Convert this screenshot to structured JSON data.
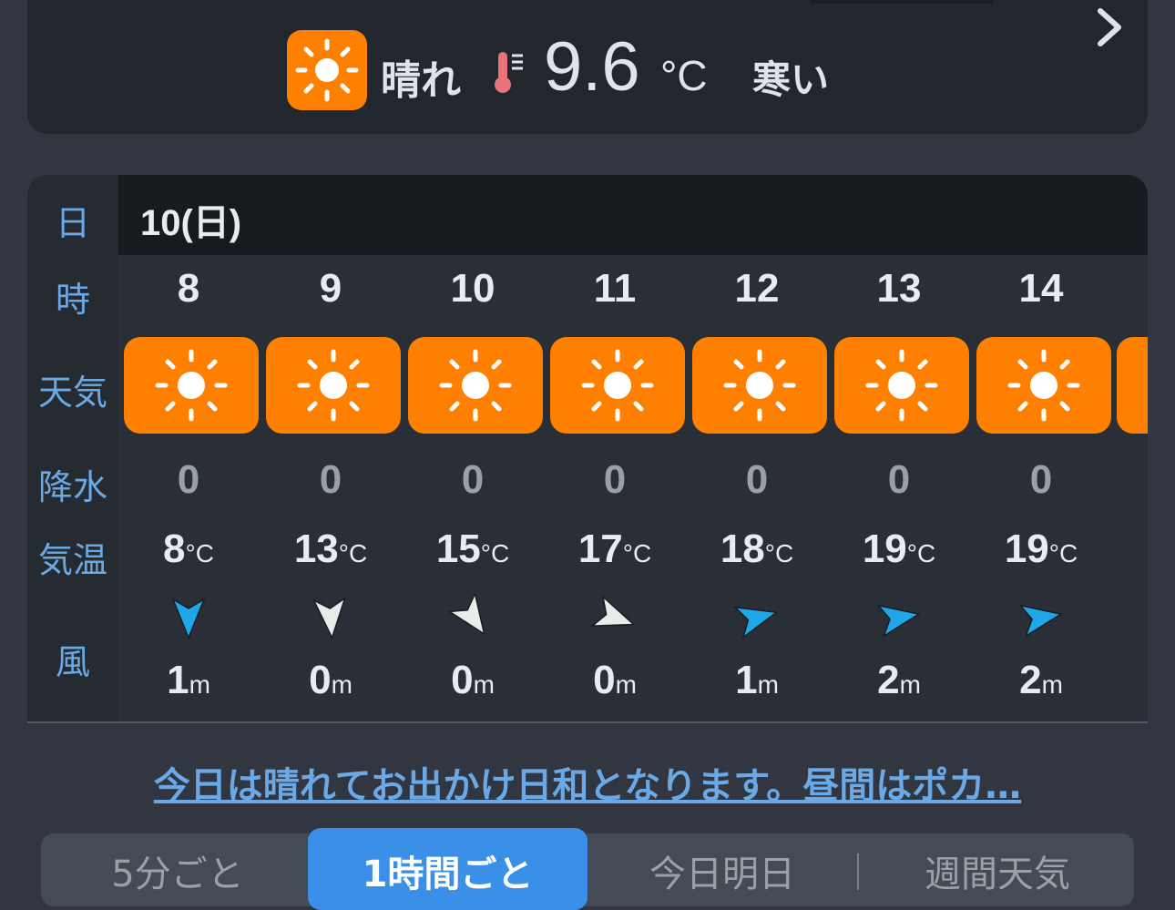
{
  "current": {
    "condition": "晴れ",
    "temperature": "9.6",
    "unit": "°C",
    "feel": "寒い",
    "icon": "sun-icon"
  },
  "table": {
    "labels": {
      "day": "日",
      "hour": "時",
      "weather": "天気",
      "precip": "降水",
      "temp": "気温",
      "wind": "風"
    },
    "day": "10(日)",
    "temp_unit": "°C",
    "wind_unit": "m",
    "hours": [
      {
        "hour": "8",
        "precip": "0",
        "temp": "8",
        "wind": "1",
        "wind_color": "#1fa8e8"
      },
      {
        "hour": "9",
        "precip": "0",
        "temp": "13",
        "wind": "0",
        "wind_color": "#e8ecea"
      },
      {
        "hour": "10",
        "precip": "0",
        "temp": "15",
        "wind": "0",
        "wind_color": "#e8ecea"
      },
      {
        "hour": "11",
        "precip": "0",
        "temp": "17",
        "wind": "0",
        "wind_color": "#e8ecea"
      },
      {
        "hour": "12",
        "precip": "0",
        "temp": "18",
        "wind": "1",
        "wind_color": "#1fa8e8"
      },
      {
        "hour": "13",
        "precip": "0",
        "temp": "19",
        "wind": "2",
        "wind_color": "#1fa8e8"
      },
      {
        "hour": "14",
        "precip": "0",
        "temp": "19",
        "wind": "2",
        "wind_color": "#1fa8e8"
      }
    ]
  },
  "summary": "今日は晴れてお出かけ日和となります。昼間はポカ…",
  "tabs": {
    "t1": "5分ごと",
    "t2": "1時間ごと",
    "t3": "今日明日",
    "t4": "週間天気"
  },
  "colors": {
    "accent": "#ff8000",
    "link": "#6aa9e6",
    "active_tab": "#3a8fe8"
  }
}
